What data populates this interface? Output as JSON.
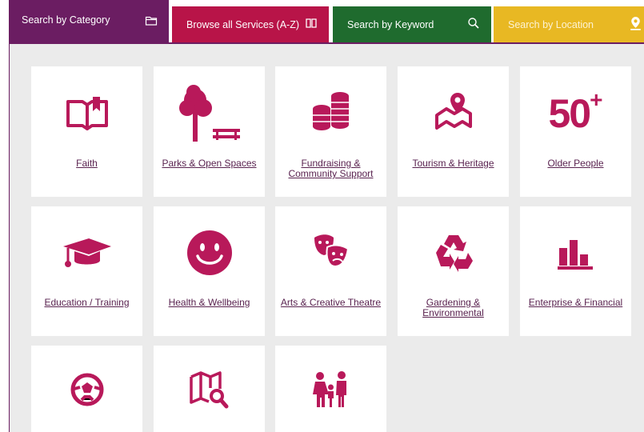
{
  "tabs": [
    {
      "label": "Search by Category",
      "icon": "folder-icon"
    },
    {
      "label": "Browse all Services (A-Z)",
      "icon": "book-icon"
    },
    {
      "label": "Search by Keyword",
      "icon": "search-icon"
    },
    {
      "label": "Search by Location",
      "icon": "location-pin-icon"
    }
  ],
  "categories": [
    {
      "label": "Faith",
      "icon": "open-book-icon"
    },
    {
      "label": "Parks & Open Spaces",
      "icon": "tree-bench-icon"
    },
    {
      "label": "Fundraising & Community Support",
      "icon": "coin-stacks-icon"
    },
    {
      "label": "Tourism & Heritage",
      "icon": "map-pin-icon"
    },
    {
      "label": "Older People",
      "icon": "fifty-plus-icon",
      "icon_text": "50",
      "icon_sup": "+"
    },
    {
      "label": "Education / Training",
      "icon": "graduation-cap-icon"
    },
    {
      "label": "Health & Wellbeing",
      "icon": "smiley-face-icon"
    },
    {
      "label": "Arts & Creative Theatre",
      "icon": "theatre-masks-icon"
    },
    {
      "label": "Gardening & Environmental",
      "icon": "recycle-icon"
    },
    {
      "label": "Enterprise & Financial",
      "icon": "bar-chart-icon"
    },
    {
      "label": "",
      "icon": "football-icon"
    },
    {
      "label": "",
      "icon": "map-search-icon"
    },
    {
      "label": "",
      "icon": "family-icon"
    }
  ],
  "colors": {
    "category_purple": "#6b1d62",
    "az_red": "#b81448",
    "keyword_green": "#1f6b2e",
    "location_yellow": "#e8b823",
    "icon_magenta": "#b8195a"
  }
}
